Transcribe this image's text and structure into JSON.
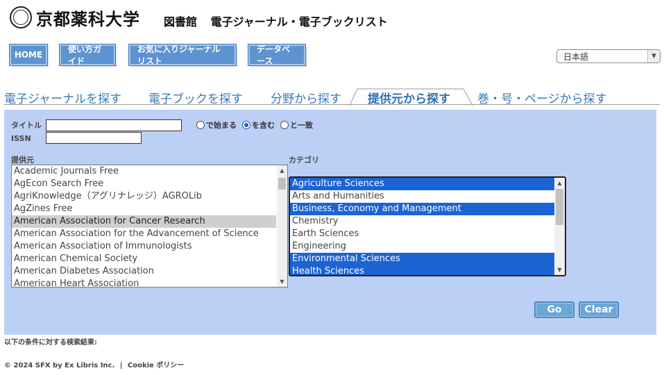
{
  "header": {
    "logo_text": "京都薬科大学",
    "library": "図書館",
    "service": "電子ジャーナル・電子ブックリスト"
  },
  "nav": {
    "home": "HOME",
    "guide": "使い方ガイド",
    "favorites": "お気に入りジャーナルリスト",
    "database": "データベース"
  },
  "language": {
    "selected": "日本語"
  },
  "tabs": [
    {
      "label": "電子ジャーナルを探す"
    },
    {
      "label": "電子ブックを探す"
    },
    {
      "label": "分野から探す"
    },
    {
      "label": "提供元から探す"
    },
    {
      "label": "巻・号・ページから探す"
    }
  ],
  "form": {
    "title_label": "タイトル",
    "issn_label": "ISSN",
    "title_value": "",
    "issn_value": "",
    "options": [
      {
        "label": "で始まる",
        "checked": false
      },
      {
        "label": "を含む",
        "checked": true
      },
      {
        "label": "と一致",
        "checked": false
      }
    ],
    "provider_label": "提供元",
    "category_label": "カテゴリ"
  },
  "providers": [
    "Academic Journals Free",
    "AgEcon Search Free",
    "AgriKnowledge（アグリナレッジ）AGROLib",
    "AgZines Free",
    "American Association for Cancer Research",
    "American Association for the Advancement of Science",
    "American Association of Immunologists",
    "American Chemical Society",
    "American Diabetes Association",
    "American Heart Association"
  ],
  "provider_selected_index": 4,
  "categories": [
    {
      "label": "Agriculture Sciences",
      "selected": true
    },
    {
      "label": "Arts and Humanities",
      "selected": false
    },
    {
      "label": "Business, Economy and Management",
      "selected": true
    },
    {
      "label": "Chemistry",
      "selected": false
    },
    {
      "label": "Earth Sciences",
      "selected": false
    },
    {
      "label": "Engineering",
      "selected": false
    },
    {
      "label": "Environmental Sciences",
      "selected": true
    },
    {
      "label": "Health Sciences",
      "selected": true
    }
  ],
  "buttons": {
    "go": "Go",
    "clear": "Clear"
  },
  "results_label": "以下の条件に対する検索結果:",
  "footer": {
    "copyright": "© 2024 SFX by Ex Libris Inc.",
    "sep": "|",
    "cookie": "Cookie ポリシー"
  }
}
